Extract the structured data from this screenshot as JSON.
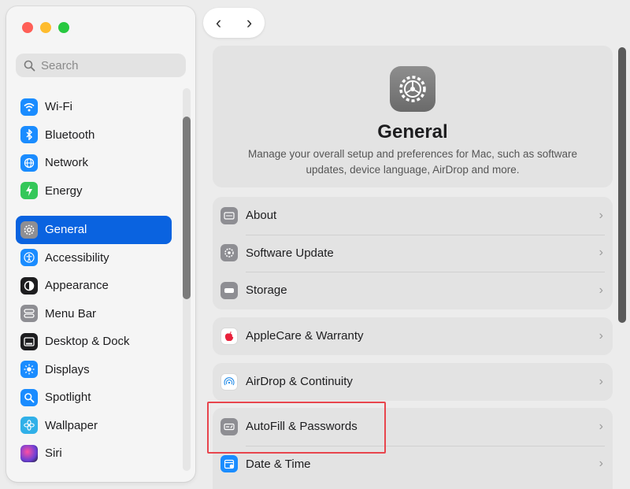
{
  "sidebar": {
    "search_placeholder": "Search",
    "items": [
      {
        "label": "Wi-Fi",
        "icon": "wifi-icon",
        "color": "#1a8cff"
      },
      {
        "label": "Bluetooth",
        "icon": "bluetooth-icon",
        "color": "#1a8cff"
      },
      {
        "label": "Network",
        "icon": "globe-icon",
        "color": "#1a8cff"
      },
      {
        "label": "Energy",
        "icon": "bolt-icon",
        "color": "#34c759"
      },
      {
        "label": "General",
        "icon": "gear-icon",
        "color": "#8e8e93",
        "selected": true
      },
      {
        "label": "Accessibility",
        "icon": "accessibility-icon",
        "color": "#1a8cff"
      },
      {
        "label": "Appearance",
        "icon": "appearance-icon",
        "color": "#1d1d1f"
      },
      {
        "label": "Menu Bar",
        "icon": "menubar-icon",
        "color": "#8e8e93"
      },
      {
        "label": "Desktop & Dock",
        "icon": "dock-icon",
        "color": "#1d1d1f"
      },
      {
        "label": "Displays",
        "icon": "sun-icon",
        "color": "#1a8cff"
      },
      {
        "label": "Spotlight",
        "icon": "magnifier-icon",
        "color": "#1a8cff"
      },
      {
        "label": "Wallpaper",
        "icon": "flower-icon",
        "color": "#30b0e8"
      },
      {
        "label": "Siri",
        "icon": "siri-icon",
        "color": "#6b3fd6"
      }
    ]
  },
  "nav": {
    "back": "‹",
    "forward": "›"
  },
  "hero": {
    "title": "General",
    "description": "Manage your overall setup and preferences for Mac, such as software updates, device language, AirDrop and more."
  },
  "groups": [
    {
      "rows": [
        {
          "label": "About",
          "icon": "about-icon",
          "color": "#8e8e93"
        },
        {
          "label": "Software Update",
          "icon": "software-update-icon",
          "color": "#8e8e93"
        },
        {
          "label": "Storage",
          "icon": "storage-icon",
          "color": "#8e8e93"
        }
      ]
    },
    {
      "rows": [
        {
          "label": "AppleCare & Warranty",
          "icon": "apple-icon",
          "color": "#ffffff"
        }
      ]
    },
    {
      "rows": [
        {
          "label": "AirDrop & Continuity",
          "icon": "airdrop-icon",
          "color": "#ffffff"
        }
      ]
    },
    {
      "rows": [
        {
          "label": "AutoFill & Passwords",
          "icon": "autofill-icon",
          "color": "#8e8e93"
        },
        {
          "label": "Date & Time",
          "icon": "calendar-icon",
          "color": "#1a8cff"
        }
      ]
    }
  ],
  "accent": "#0a63e0",
  "highlight_color": "#e8454d"
}
